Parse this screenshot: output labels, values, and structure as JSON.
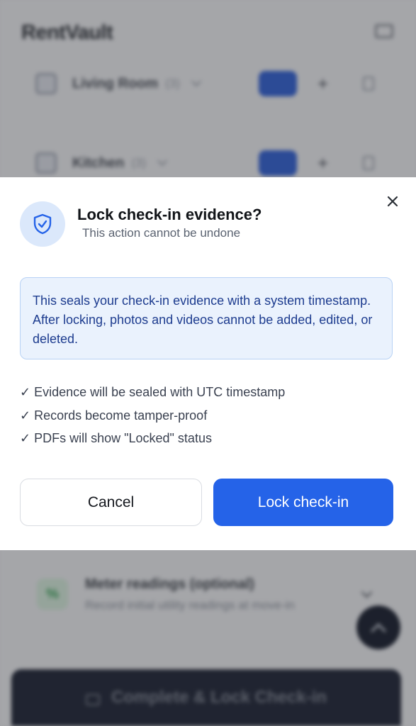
{
  "background": {
    "logo": "RentVault",
    "rooms": [
      {
        "name": "Living Room",
        "count": "(3)"
      },
      {
        "name": "Kitchen",
        "count": "(3)"
      }
    ],
    "meter": {
      "title": "Meter readings (optional)",
      "subtitle": "Record initial utility readings at move-in"
    },
    "fab_icon": "chevron-up-icon",
    "bottom_button_label": "Complete & Lock Check-in"
  },
  "modal": {
    "title": "Lock check-in evidence?",
    "subtitle": "This action cannot be undone",
    "icon": "shield-check-icon",
    "info_text": "This seals your check-in evidence with a system timestamp. After locking, photos and videos cannot be added, edited, or deleted.",
    "checklist": [
      "✓ Evidence will be sealed with UTC timestamp",
      "✓ Records become tamper-proof",
      "✓ PDFs will show \"Locked\" status"
    ],
    "cancel_label": "Cancel",
    "confirm_label": "Lock check-in",
    "close_icon": "close-icon"
  },
  "colors": {
    "primary": "#2563e8",
    "info_bg": "#eaf2fd",
    "info_border": "#b8d2f5",
    "info_text": "#1d3c8f",
    "icon_badge": "#dbe8fb"
  }
}
